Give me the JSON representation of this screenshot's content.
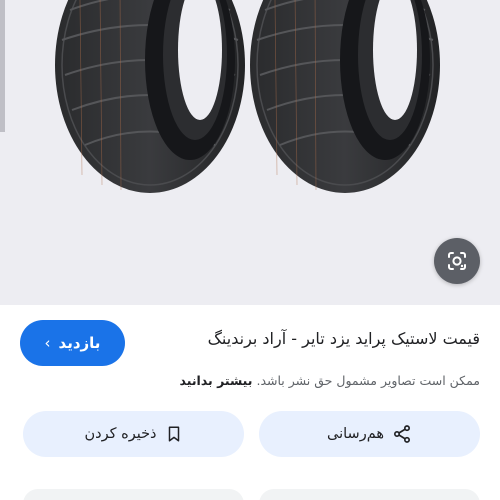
{
  "result": {
    "title": "قیمت لاستیک پراید یزد تایر - آراد برندینگ",
    "visit_label": "بازدید",
    "notice_text": "ممکن است تصاویر مشمول حق نشر باشد.",
    "notice_more": "بیشتر بدانید"
  },
  "actions": {
    "share_label": "هم‌رسانی",
    "save_label": "ذخیره کردن"
  },
  "icons": {
    "lens": "google-lens-icon",
    "share": "share-icon",
    "save": "bookmark-icon",
    "visit": "chevron-left-icon"
  },
  "colors": {
    "primary": "#1a73e8",
    "action_bg": "#e8f0fe",
    "image_bg": "#ededf2"
  }
}
